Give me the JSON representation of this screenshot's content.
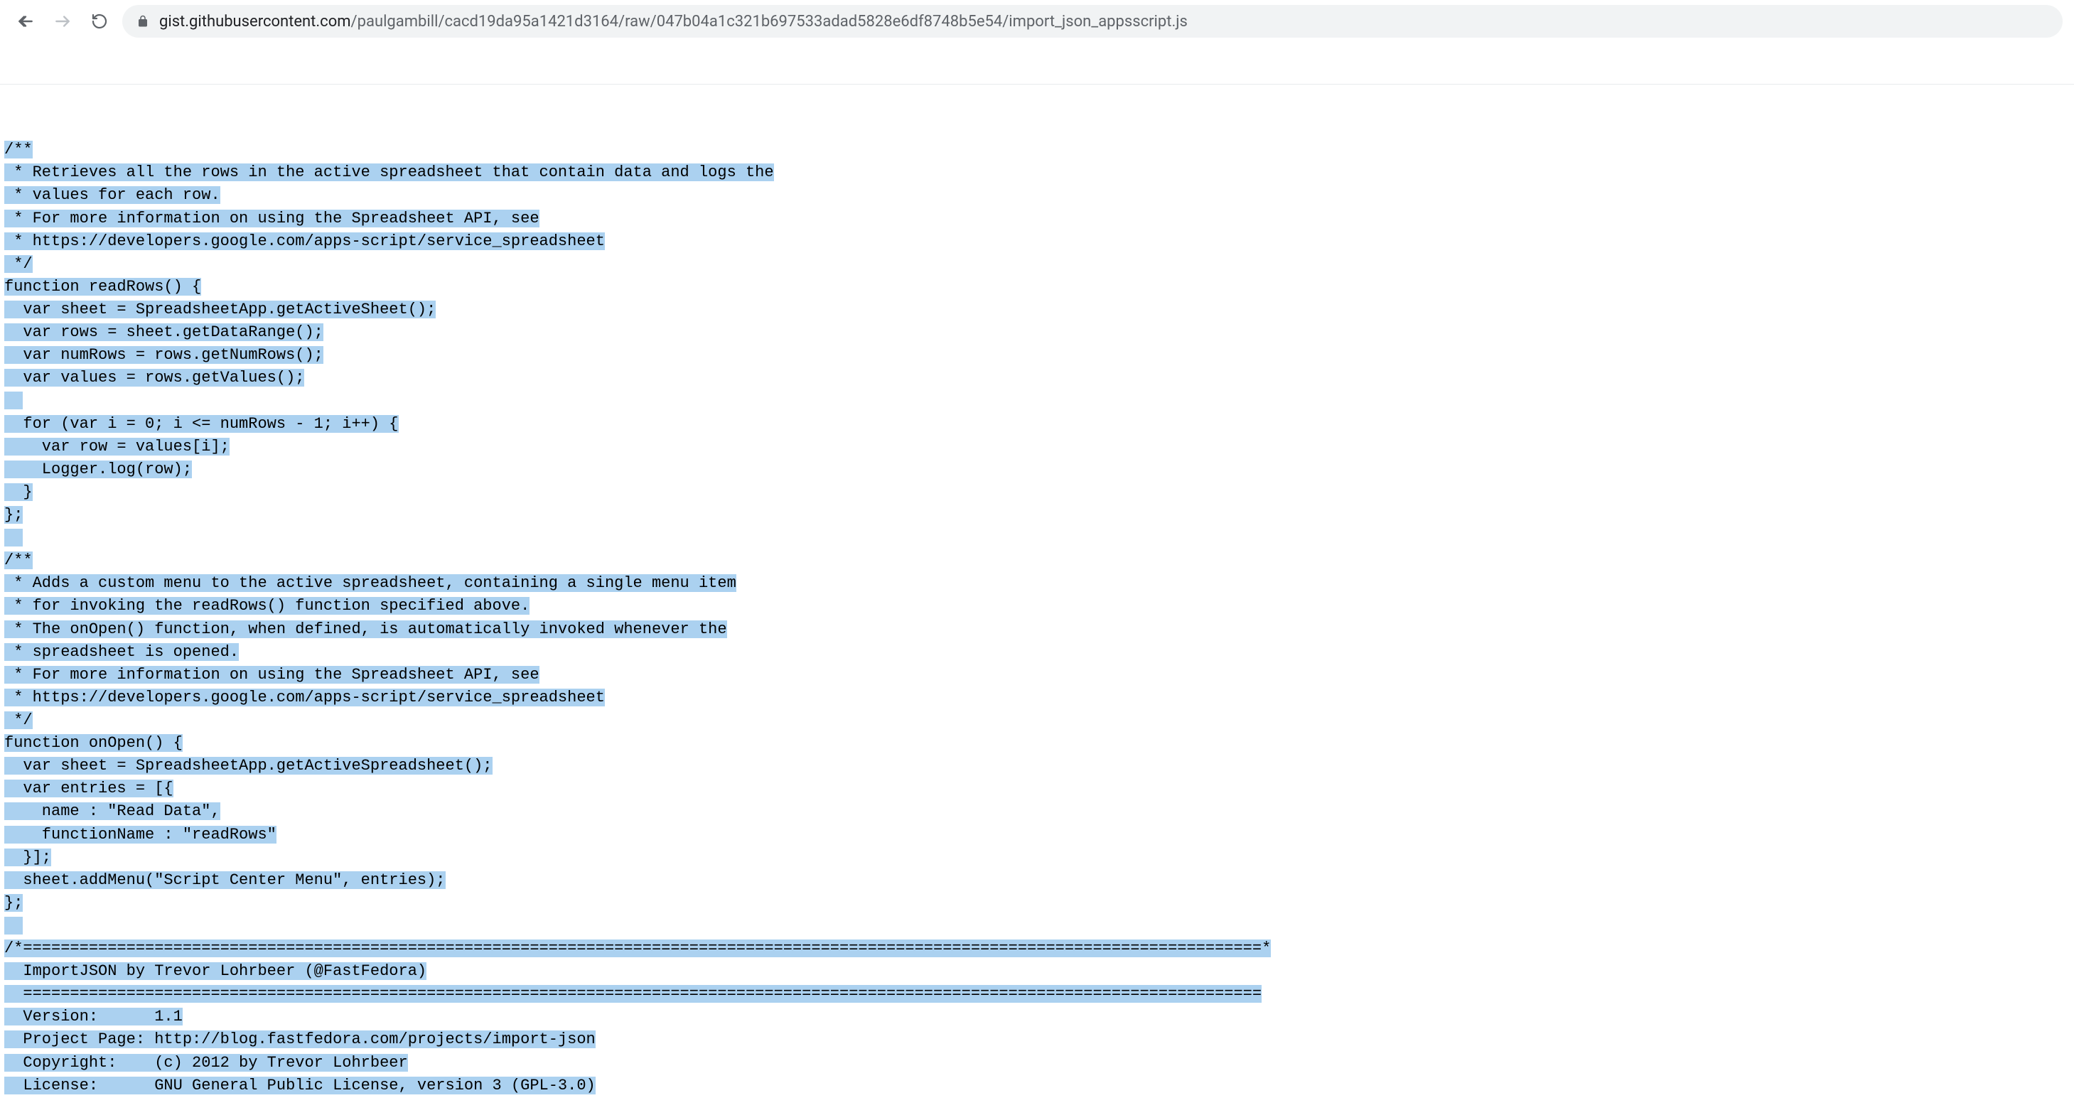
{
  "url": {
    "domain": "gist.githubusercontent.com",
    "path": "/paulgambill/cacd19da95a1421d3164/raw/047b04a1c321b697533adad5828e6df8748b5e54/import_json_appsscript.js"
  },
  "code": {
    "lines": [
      "/**",
      " * Retrieves all the rows in the active spreadsheet that contain data and logs the",
      " * values for each row.",
      " * For more information on using the Spreadsheet API, see",
      " * https://developers.google.com/apps-script/service_spreadsheet",
      " */",
      "function readRows() {",
      "  var sheet = SpreadsheetApp.getActiveSheet();",
      "  var rows = sheet.getDataRange();",
      "  var numRows = rows.getNumRows();",
      "  var values = rows.getValues();",
      "",
      "  for (var i = 0; i <= numRows - 1; i++) {",
      "    var row = values[i];",
      "    Logger.log(row);",
      "  }",
      "};",
      "",
      "/**",
      " * Adds a custom menu to the active spreadsheet, containing a single menu item",
      " * for invoking the readRows() function specified above.",
      " * The onOpen() function, when defined, is automatically invoked whenever the",
      " * spreadsheet is opened.",
      " * For more information on using the Spreadsheet API, see",
      " * https://developers.google.com/apps-script/service_spreadsheet",
      " */",
      "function onOpen() {",
      "  var sheet = SpreadsheetApp.getActiveSpreadsheet();",
      "  var entries = [{",
      "    name : \"Read Data\",",
      "    functionName : \"readRows\"",
      "  }];",
      "  sheet.addMenu(\"Script Center Menu\", entries);",
      "};",
      "",
      "/*====================================================================================================================================*",
      "  ImportJSON by Trevor Lohrbeer (@FastFedora)",
      "  ====================================================================================================================================",
      "  Version:      1.1",
      "  Project Page: http://blog.fastfedora.com/projects/import-json",
      "  Copyright:    (c) 2012 by Trevor Lohrbeer",
      "  License:      GNU General Public License, version 3 (GPL-3.0)"
    ]
  }
}
